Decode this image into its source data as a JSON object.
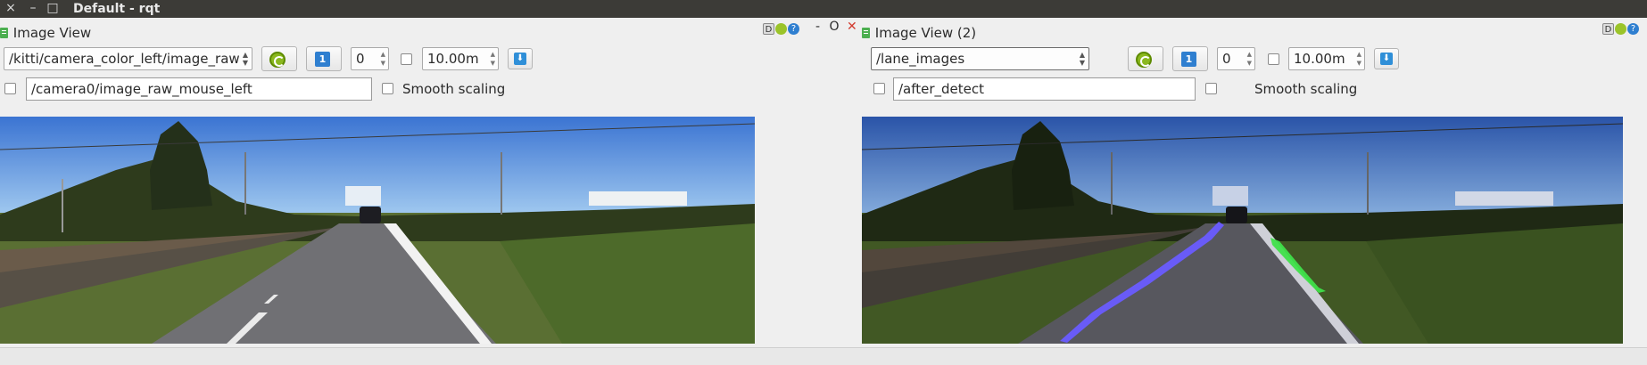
{
  "window": {
    "title": "Default - rqt",
    "close_glyph": "×",
    "minimize_glyph": "–",
    "maximize_glyph": "□"
  },
  "left": {
    "title": "Image View",
    "topic": "/kitti/camera_color_left/image_raw",
    "spin_value": "0",
    "max_range": "10.00m",
    "mouse_topic": "/camera0/image_raw_mouse_left",
    "smooth_label": "Smooth scaling",
    "dock_help_glyph": "?",
    "dock_d_glyph": "D"
  },
  "separator": {
    "minimize_glyph": "-",
    "options_glyph": "O",
    "close_glyph": "✕"
  },
  "right": {
    "title": "Image View (2)",
    "topic": "/lane_images",
    "spin_value": "0",
    "max_range": "10.00m",
    "mouse_topic": "/after_detect",
    "smooth_label": "Smooth scaling",
    "dock_help_glyph": "?",
    "dock_d_glyph": "D"
  },
  "colors": {
    "sky_top": "#3d79d6",
    "sky_bottom": "#a9cff0",
    "grass": "#4f6b2a",
    "road": "#6f6f72",
    "lane_left": "#6a5cff",
    "lane_right": "#3fe04a"
  }
}
